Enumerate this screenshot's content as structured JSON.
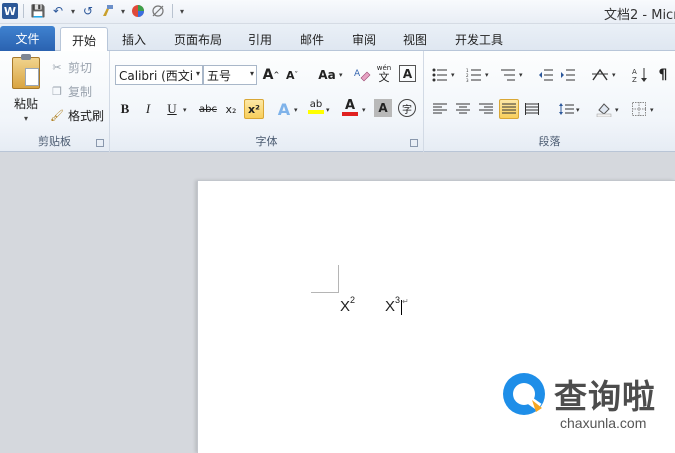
{
  "window": {
    "title": "文档2 - Micr"
  },
  "qat": {
    "logo": "W",
    "save": "💾",
    "undo": "↶",
    "redo": "↺",
    "customize": "▾"
  },
  "tabs": [
    {
      "label": "文件"
    },
    {
      "label": "开始"
    },
    {
      "label": "插入"
    },
    {
      "label": "页面布局"
    },
    {
      "label": "引用"
    },
    {
      "label": "邮件"
    },
    {
      "label": "审阅"
    },
    {
      "label": "视图"
    },
    {
      "label": "开发工具"
    }
  ],
  "clipboard": {
    "paste": "粘贴",
    "cut": "剪切",
    "copy": "复制",
    "format_painter": "格式刷",
    "group_label": "剪贴板"
  },
  "font": {
    "family": "Calibri (西文i",
    "size": "五号",
    "grow": "A",
    "shrink": "A",
    "change_case": "Aa",
    "phonetic": "wén",
    "bold": "B",
    "italic": "I",
    "underline": "U",
    "strikethrough": "abc",
    "subscript": "x₂",
    "superscript": "x²",
    "effects": "A",
    "highlight": "ab",
    "color": "A",
    "shading": "A",
    "enclose": "字",
    "group_label": "字体"
  },
  "paragraph": {
    "group_label": "段落"
  },
  "document": {
    "expr1": {
      "base": "X",
      "exp": "2"
    },
    "expr2": {
      "base": "X",
      "exp": "3"
    }
  },
  "watermark": {
    "name": "查询啦",
    "url": "chaxunla.com"
  },
  "colors": {
    "file_tab": "#2a62b0",
    "accent": "#2b579a",
    "font_color_bar": "#e02020",
    "highlight_bar": "#ffff00"
  }
}
